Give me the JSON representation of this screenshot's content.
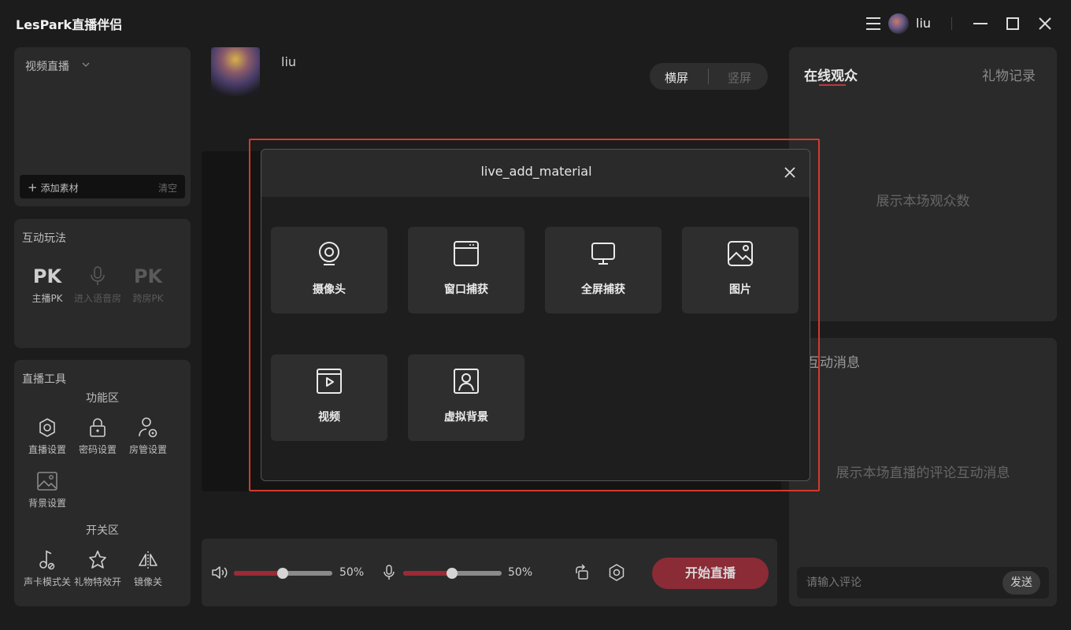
{
  "app": {
    "title": "LesPark直播伴侣"
  },
  "titlebar": {
    "username": "liu"
  },
  "left": {
    "source_panel": {
      "mode_label": "视频直播",
      "add_label": "添加素材",
      "clear_label": "清空"
    },
    "interactive": {
      "title": "互动玩法",
      "items": [
        {
          "glyph": "PK",
          "label": "主播PK",
          "enabled": true
        },
        {
          "glyph": "",
          "label": "进入语音房",
          "enabled": false
        },
        {
          "glyph": "PK",
          "label": "跨房PK",
          "enabled": false
        }
      ]
    },
    "tools": {
      "title": "直播工具",
      "function_area_title": "功能区",
      "function_items": [
        "直播设置",
        "密码设置",
        "房管设置",
        "背景设置"
      ],
      "switch_area_title": "开关区",
      "switch_items": [
        "声卡模式关",
        "礼物特效开",
        "镜像关"
      ]
    }
  },
  "center": {
    "streamer_name": "liu",
    "orientation": {
      "landscape": "横屏",
      "portrait": "竖屏"
    },
    "controls": {
      "speaker_volume": "50%",
      "mic_volume": "50%",
      "start_button": "开始直播"
    }
  },
  "right": {
    "tabs": {
      "online": "在线观众",
      "gifts": "礼物记录"
    },
    "audience_placeholder": "展示本场观众数",
    "messages_title": "互动消息",
    "messages_placeholder": "展示本场直播的评论互动消息",
    "comment_placeholder": "请输入评论",
    "send_label": "发送"
  },
  "modal": {
    "title": "live_add_material",
    "tiles": [
      {
        "icon": "camera-icon",
        "label": "摄像头"
      },
      {
        "icon": "window-capture-icon",
        "label": "窗口捕获"
      },
      {
        "icon": "monitor-icon",
        "label": "全屏捕获"
      },
      {
        "icon": "image-icon",
        "label": "图片"
      },
      {
        "icon": "video-icon",
        "label": "视频"
      },
      {
        "icon": "portrait-icon",
        "label": "虚拟背景"
      }
    ]
  },
  "colors": {
    "accent": "#c0353f",
    "highlight_border": "#d33a2c",
    "start_button": "#8a2b36"
  }
}
